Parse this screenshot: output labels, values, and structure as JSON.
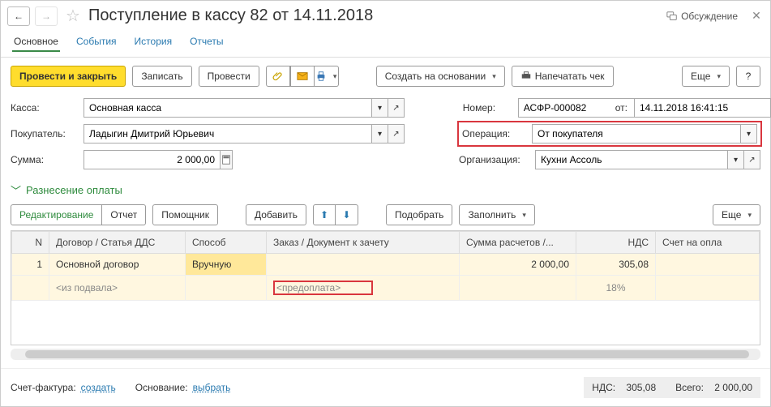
{
  "title": "Поступление в кассу 82 от 14.11.2018",
  "tabs": {
    "main": "Основное",
    "events": "События",
    "history": "История",
    "reports": "Отчеты"
  },
  "toolbar": {
    "post_close": "Провести и закрыть",
    "save": "Записать",
    "post": "Провести",
    "create_based": "Создать на основании",
    "print_check": "Напечатать чек",
    "more": "Еще",
    "help": "?"
  },
  "discuss": "Обсуждение",
  "form": {
    "kassa_label": "Касса:",
    "kassa_value": "Основная касса",
    "number_label": "Номер:",
    "number_value": "АСФР-000082",
    "ot_label": "от:",
    "date_value": "14.11.2018 16:41:15",
    "buyer_label": "Покупатель:",
    "buyer_value": "Ладыгин Дмитрий Юрьевич",
    "operation_label": "Операция:",
    "operation_value": "От покупателя",
    "summa_label": "Сумма:",
    "summa_value": "2 000,00",
    "org_label": "Организация:",
    "org_value": "Кухни Ассоль"
  },
  "section": "Разнесение оплаты",
  "subtoolbar": {
    "edit": "Редактирование",
    "report": "Отчет",
    "helper": "Помощник",
    "add": "Добавить",
    "pick": "Подобрать",
    "fill": "Заполнить",
    "more": "Еще"
  },
  "table": {
    "headers": {
      "n": "N",
      "dog": "Договор / Статья ДДС",
      "sposob": "Способ",
      "zakaz": "Заказ / Документ к зачету",
      "sum": "Сумма расчетов /...",
      "nds": "НДС",
      "schet": "Счет на опла"
    },
    "rows": [
      {
        "n": "1",
        "dog": "Основной договор",
        "sposob": "Вручную",
        "zakaz": "",
        "sum": "2 000,00",
        "nds": "305,08",
        "schet": ""
      },
      {
        "n": "",
        "dog": "<из подвала>",
        "sposob": "",
        "zakaz": "<предоплата>",
        "sum": "",
        "nds": "18%",
        "schet": ""
      }
    ]
  },
  "footer": {
    "sf_label": "Счет-фактура:",
    "sf_link": "создать",
    "osn_label": "Основание:",
    "osn_link": "выбрать",
    "nds_label": "НДС:",
    "nds_value": "305,08",
    "total_label": "Всего:",
    "total_value": "2 000,00"
  }
}
